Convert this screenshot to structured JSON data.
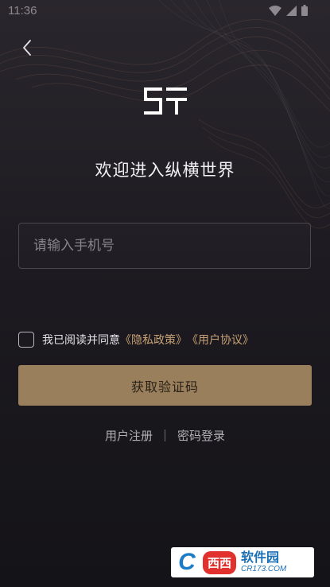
{
  "status_bar": {
    "time": "11:36",
    "icons": [
      "wifi-icon",
      "signal-icon",
      "battery-icon"
    ]
  },
  "header": {
    "back_icon": "chevron-left-icon"
  },
  "brand": {
    "logo_name": "zongheng-logo"
  },
  "welcome": {
    "title": "欢迎进入纵横世界"
  },
  "login_form": {
    "phone_placeholder": "请输入手机号",
    "phone_value": "",
    "agree_prefix": "我已阅读并同意",
    "privacy_policy": "《隐私政策》",
    "user_agreement": "《用户协议》",
    "agree_checked": false,
    "get_code_label": "获取验证码"
  },
  "bottom_links": {
    "register": "用户注册",
    "password_login": "密码登录"
  },
  "watermark": {
    "letter": "C",
    "xixi": "西西",
    "name": "软件园",
    "domain": "CR173.COM"
  },
  "colors": {
    "accent_gold": "#9a7f5c",
    "link_gold": "#c8a275",
    "background": "#1d1b21"
  }
}
